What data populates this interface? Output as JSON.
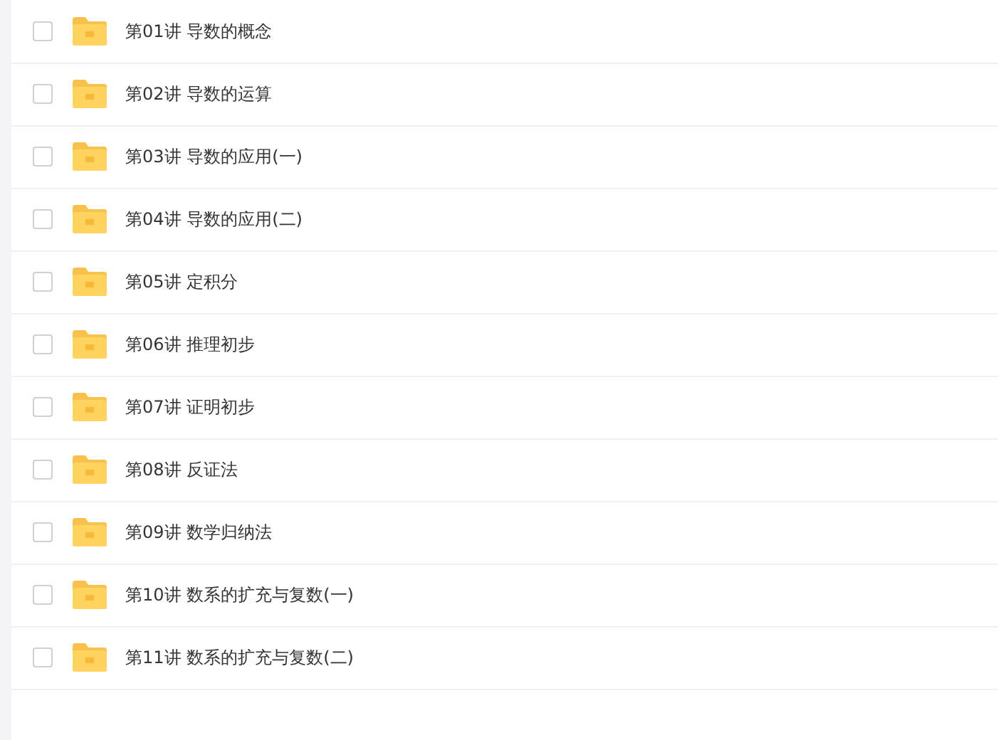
{
  "files": [
    {
      "label": "第01讲 导数的概念",
      "checked": false
    },
    {
      "label": "第02讲 导数的运算",
      "checked": false
    },
    {
      "label": "第03讲 导数的应用(一)",
      "checked": false
    },
    {
      "label": "第04讲 导数的应用(二)",
      "checked": false
    },
    {
      "label": "第05讲 定积分",
      "checked": false
    },
    {
      "label": "第06讲 推理初步",
      "checked": false
    },
    {
      "label": "第07讲 证明初步",
      "checked": false
    },
    {
      "label": "第08讲 反证法",
      "checked": false
    },
    {
      "label": "第09讲 数学归纳法",
      "checked": false
    },
    {
      "label": "第10讲 数系的扩充与复数(一)",
      "checked": false
    },
    {
      "label": "第11讲 数系的扩充与复数(二)",
      "checked": false
    }
  ]
}
